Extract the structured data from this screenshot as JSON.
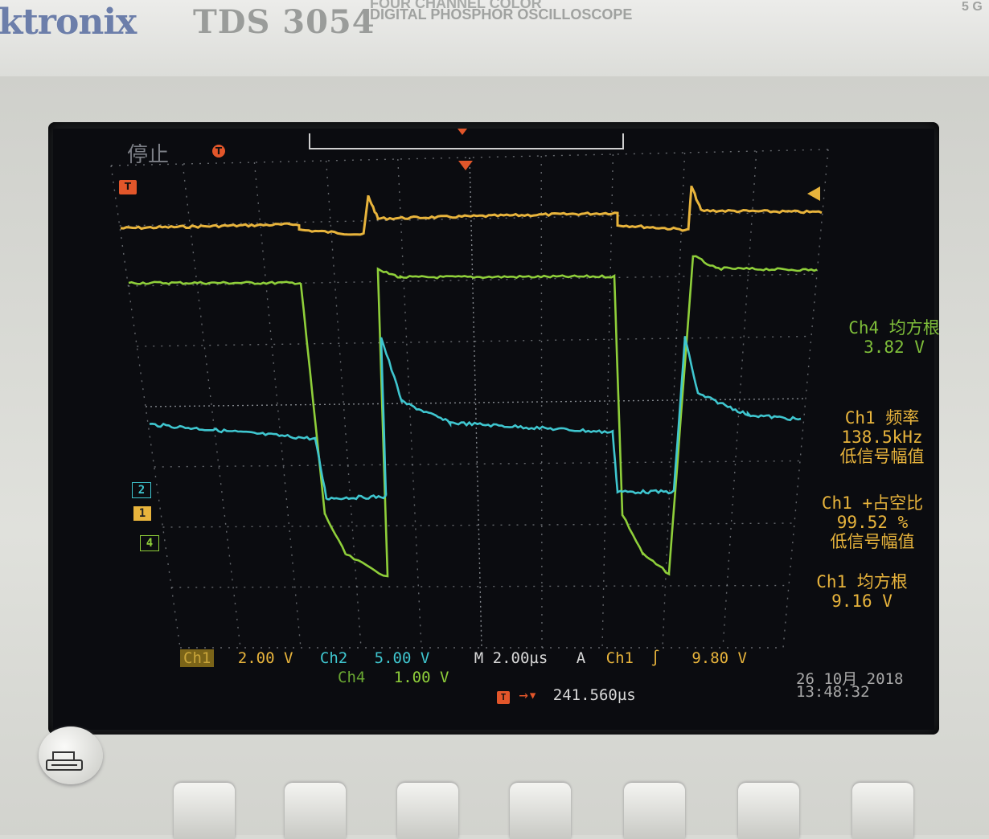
{
  "device": {
    "brand": "ktronix",
    "model": "TDS 3054",
    "desc_line1": "FOUR CHANNEL COLOR",
    "desc_line2": "DIGITAL PHOSPHOR OSCILLOSCOPE",
    "corner": "5 G"
  },
  "status": {
    "run_state": "停止",
    "trigger_marker": "T",
    "ch1_marker": "1",
    "ch2_marker": "2",
    "ch4_marker": "4"
  },
  "measurements": [
    {
      "line1": "Ch4 均方根",
      "line2": "3.82 V",
      "line3": "",
      "color": "#7fbf3a"
    },
    {
      "line1": "Ch1 频率",
      "line2": "138.5kHz",
      "line3": "低信号幅值",
      "color": "#e8b43c"
    },
    {
      "line1": "Ch1 +占空比",
      "line2": "99.52 %",
      "line3": "低信号幅值",
      "color": "#e8b43c"
    },
    {
      "line1": "Ch1 均方根",
      "line2": "9.16 V",
      "line3": "",
      "color": "#e8b43c"
    }
  ],
  "settings": {
    "ch1_label": "Ch1",
    "ch1_scale": "2.00 V",
    "ch2_label": "Ch2",
    "ch2_scale": "5.00 V",
    "ch4_label": "Ch4",
    "ch4_scale": "1.00 V",
    "timebase": "M 2.00µs",
    "trigger_mode": "A",
    "trigger_source": "Ch1",
    "trigger_slope": "∫",
    "trigger_level": "9.80 V",
    "trigger_position": "241.560µs",
    "date": "26 10月 2018",
    "time": "13:48:32"
  },
  "colors": {
    "ch1": "#e8b43c",
    "ch2": "#3fc6cf",
    "ch4": "#8fcf3a",
    "grid": "#8a8e94"
  }
}
